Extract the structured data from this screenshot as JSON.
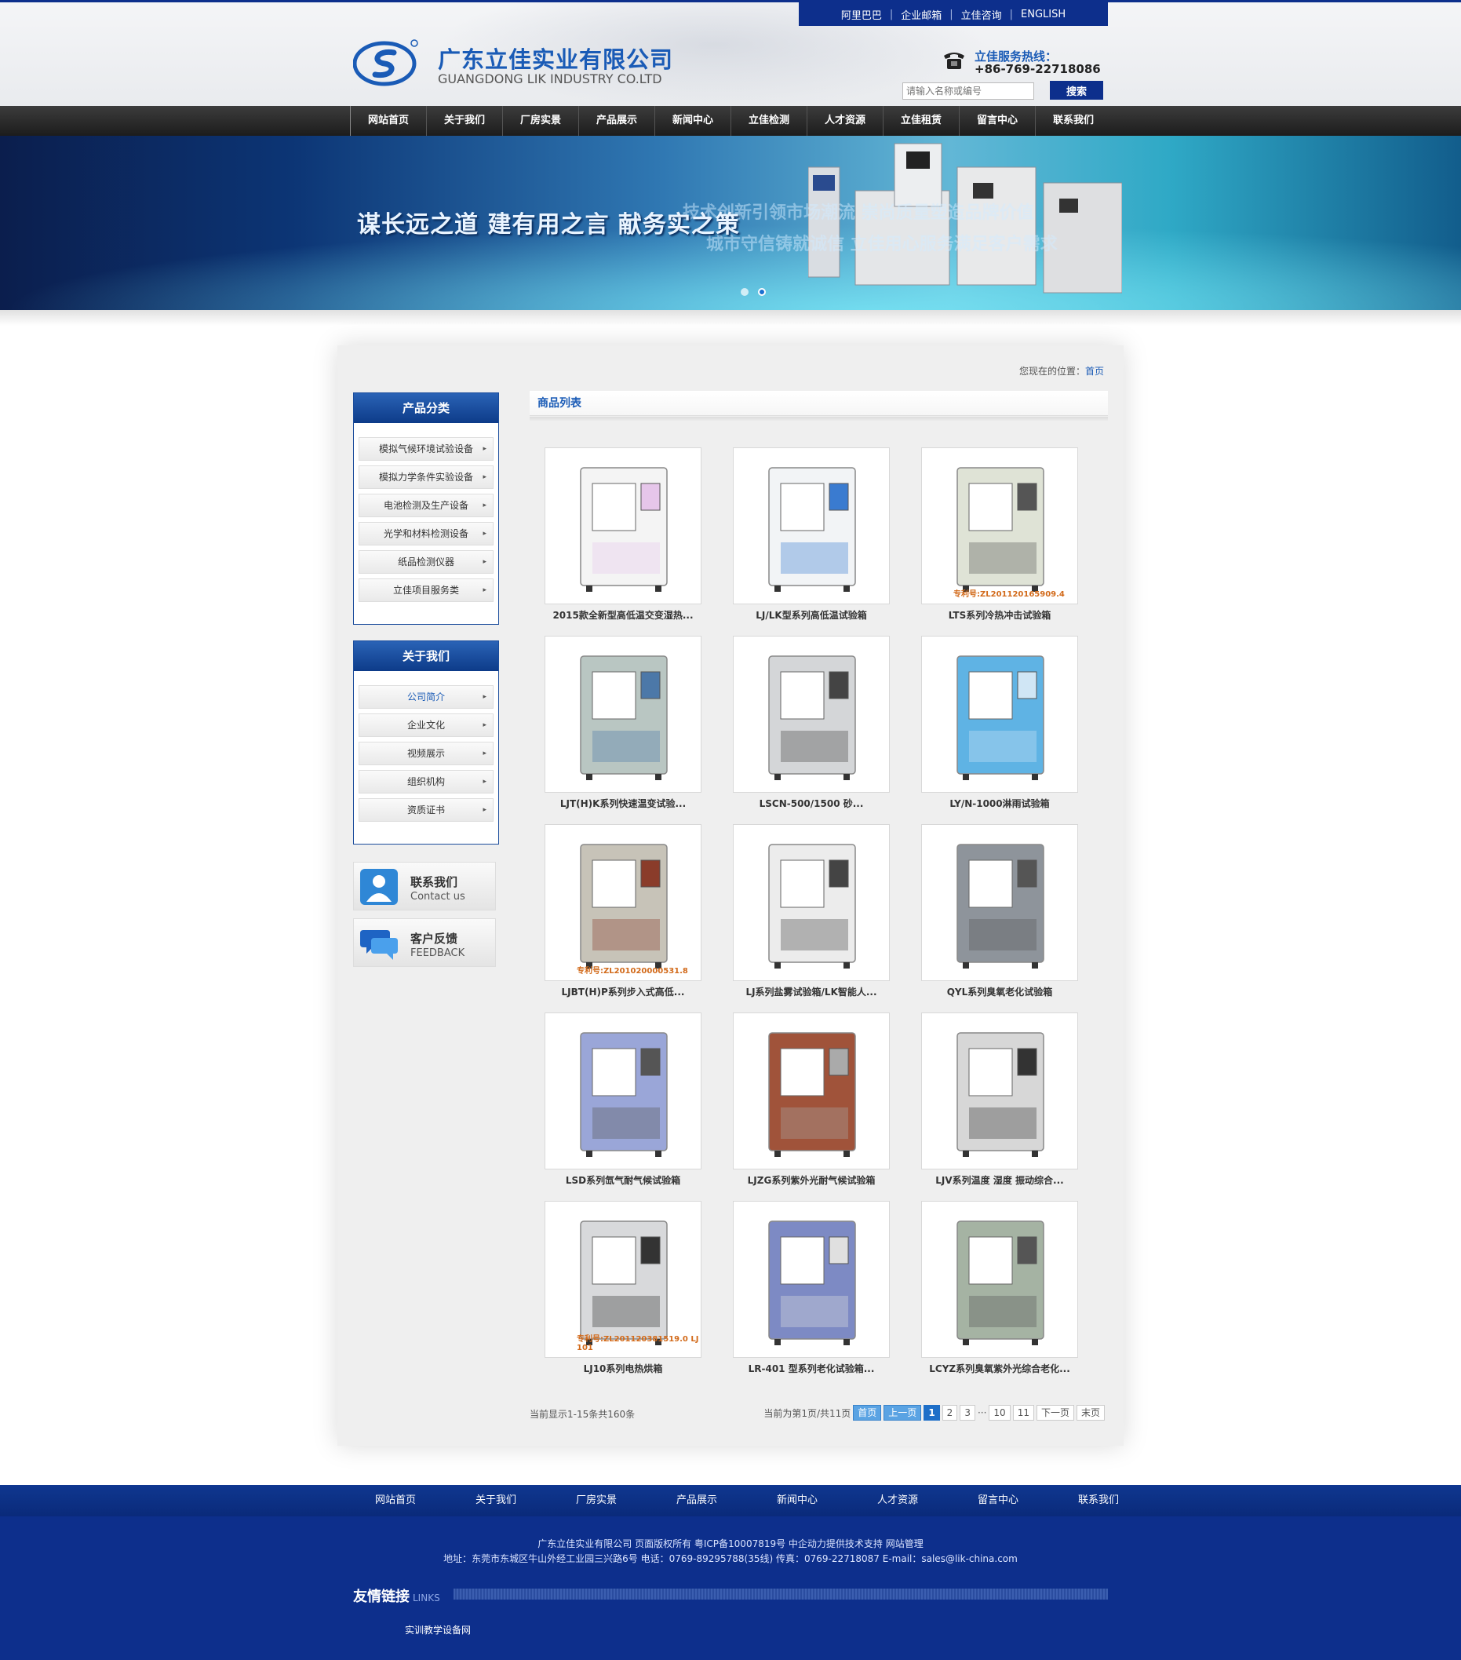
{
  "top_links": [
    "阿里巴巴",
    "企业邮箱",
    "立佳咨询",
    "ENGLISH"
  ],
  "company": {
    "name_cn": "广东立佳实业有限公司",
    "name_en": "GUANGDONG LIK INDUSTRY CO.LTD",
    "hotline_label": "立佳服务热线：",
    "hotline_number": "+86-769-22718086"
  },
  "search": {
    "placeholder": "请输入名称或编号",
    "button": "搜索"
  },
  "nav": [
    "网站首页",
    "关于我们",
    "厂房实景",
    "产品展示",
    "新闻中心",
    "立佳检测",
    "人才资源",
    "立佳租赁",
    "留言中心",
    "联系我们"
  ],
  "banner": {
    "slogan": "谋长远之道  建有用之言  献务实之策",
    "sub_line_1": "技术创新引领市场潮流 崇尚质量塑造品牌价值",
    "sub_line_2": "城市守信铸就诚信 立佳用心服务满足客户需求"
  },
  "breadcrumb": {
    "prefix": "您现在的位置：",
    "home": "首页"
  },
  "sidebar": {
    "categories_title": "产品分类",
    "categories": [
      "模拟气候环境试验设备",
      "模拟力学条件实验设备",
      "电池检测及生产设备",
      "光学和材料检测设备",
      "纸品检测仪器",
      "立佳项目服务类"
    ],
    "about_title": "关于我们",
    "about": [
      "公司简介",
      "企业文化",
      "视频展示",
      "组织机构",
      "资质证书"
    ],
    "contact_cn": "联系我们",
    "contact_en": "Contact us",
    "feedback_cn": "客户反馈",
    "feedback_en": "FEEDBACK"
  },
  "list_title": "商品列表",
  "products": [
    {
      "name": "2015款全新型高低温交变湿热...",
      "patent": ""
    },
    {
      "name": "LJ/LK型系列高低温试验箱",
      "patent": ""
    },
    {
      "name": "LTS系列冷热冲击试验箱",
      "patent": "专利号:ZL201120165909.4"
    },
    {
      "name": "LJT(H)K系列快速温变试验...",
      "patent": ""
    },
    {
      "name": "LSCN-500/1500 砂...",
      "patent": ""
    },
    {
      "name": "LY/N-1000淋雨试验箱",
      "patent": ""
    },
    {
      "name": "LJBT(H)P系列步入式高低...",
      "patent": "专利号:ZL201020000531.8"
    },
    {
      "name": "LJ系列盐雾试验箱/LK智能人...",
      "patent": ""
    },
    {
      "name": "QYL系列臭氧老化试验箱",
      "patent": ""
    },
    {
      "name": "LSD系列氙气耐气候试验箱",
      "patent": ""
    },
    {
      "name": "LJZG系列紫外光耐气候试验箱",
      "patent": ""
    },
    {
      "name": "LJV系列温度 湿度 振动综合...",
      "patent": ""
    },
    {
      "name": "LJ10系列电热烘箱",
      "patent": "专利号:ZL201120381519.0  LJ 101"
    },
    {
      "name": "LR-401 型系列老化试验箱...",
      "patent": ""
    },
    {
      "name": "LCYZ系列臭氧紫外光综合老化...",
      "patent": ""
    }
  ],
  "pager": {
    "info": "当前显示1-15条共160条",
    "status": "当前为第1页/共11页",
    "first": "首页",
    "prev": "上一页",
    "pages": [
      "1",
      "2",
      "3"
    ],
    "ellipsis": "···",
    "tail_pages": [
      "10",
      "11"
    ],
    "next": "下一页",
    "last": "末页"
  },
  "footer": {
    "nav": [
      "网站首页",
      "关于我们",
      "厂房实景",
      "产品展示",
      "新闻中心",
      "人才资源",
      "留言中心",
      "联系我们"
    ],
    "copyright_line": "广东立佳实业有限公司  页面版权所有    粤ICP备10007819号    中企动力提供技术支持    网站管理",
    "address_line": "地址：东莞市东城区牛山外经工业园三兴路6号   电话：0769-89295788(35线)   传真：0769-22718087   E-mail：sales@lik-china.com",
    "links_title": "友情链接",
    "links_en": "LINKS",
    "links": [
      "实训教学设备网"
    ]
  },
  "colors": {
    "brand_blue": "#0d2f8c",
    "accent_blue": "#1a5bb6",
    "nav_dark": "#2a2a2a"
  }
}
